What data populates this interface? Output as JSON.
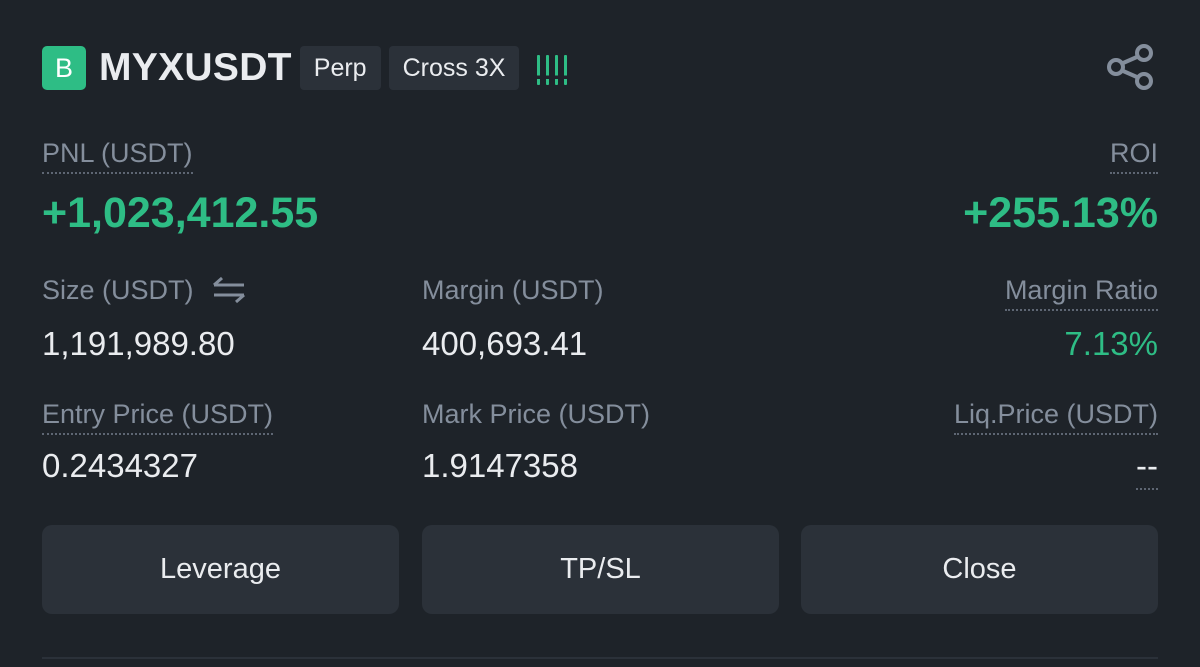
{
  "position": {
    "side_badge": "B",
    "symbol": "MYXUSDT",
    "contract_type": "Perp",
    "margin_mode": "Cross 3X",
    "signal_icon": "signal-bars-icon",
    "share_icon": "share-icon"
  },
  "pnl": {
    "label": "PNL (USDT)",
    "value": "+1,023,412.55"
  },
  "roi": {
    "label": "ROI",
    "value": "+255.13%"
  },
  "size": {
    "label": "Size (USDT)",
    "value": "1,191,989.80",
    "icon": "swap-arrows-icon"
  },
  "margin": {
    "label": "Margin (USDT)",
    "value": "400,693.41"
  },
  "margin_ratio": {
    "label": "Margin Ratio",
    "value": "7.13%"
  },
  "entry_price": {
    "label": "Entry Price (USDT)",
    "value": "0.2434327"
  },
  "mark_price": {
    "label": "Mark Price (USDT)",
    "value": "1.9147358"
  },
  "liq_price": {
    "label": "Liq.Price (USDT)",
    "value": "--"
  },
  "actions": {
    "leverage": "Leverage",
    "tpsl": "TP/SL",
    "close": "Close"
  },
  "colors": {
    "background": "#1e2329",
    "positive": "#2ebd85",
    "muted": "#848e9c",
    "button": "#2b3139"
  }
}
